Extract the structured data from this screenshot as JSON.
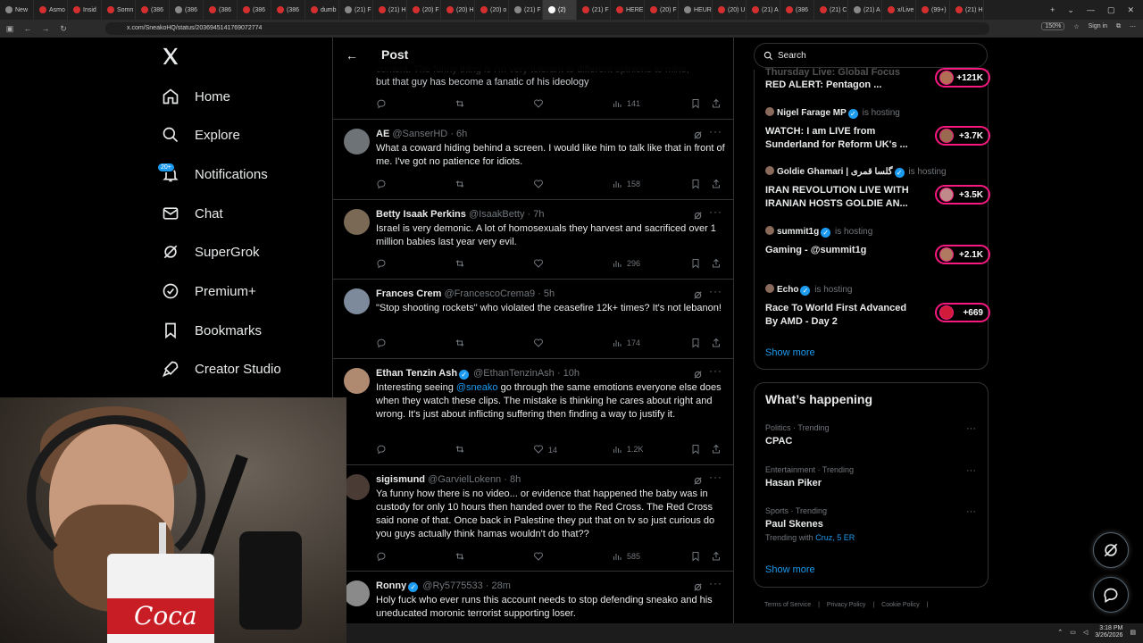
{
  "browser": {
    "tabs": [
      {
        "label": "New"
      },
      {
        "label": "Asmo"
      },
      {
        "label": "Insid"
      },
      {
        "label": "Somn"
      },
      {
        "label": "(386"
      },
      {
        "label": "(386"
      },
      {
        "label": "(386"
      },
      {
        "label": "(386"
      },
      {
        "label": "(386"
      },
      {
        "label": "dumb"
      },
      {
        "label": "(21) F"
      },
      {
        "label": "(21) H"
      },
      {
        "label": "(20) F"
      },
      {
        "label": "(20) H"
      },
      {
        "label": "(20) o"
      },
      {
        "label": "(21) F"
      },
      {
        "label": "(2)"
      },
      {
        "label": "(21) F"
      },
      {
        "label": "HERE"
      },
      {
        "label": "(20) F"
      },
      {
        "label": "HEUR"
      },
      {
        "label": "(20) U"
      },
      {
        "label": "(21) A"
      },
      {
        "label": "(386"
      },
      {
        "label": "(21) C"
      },
      {
        "label": "(21) A"
      },
      {
        "label": "x/Live"
      },
      {
        "label": "(99+)"
      },
      {
        "label": "(21) H"
      }
    ],
    "active_tab_index": 16,
    "url": "x.com/SneakoHQ/status/2036945141769072774",
    "zoom": "150%",
    "sign_in": "Sign in",
    "new_tab": "+"
  },
  "nav": {
    "items": [
      {
        "label": "Home",
        "icon": "home-icon"
      },
      {
        "label": "Explore",
        "icon": "search-icon"
      },
      {
        "label": "Notifications",
        "icon": "bell-icon"
      },
      {
        "label": "Chat",
        "icon": "mail-icon"
      },
      {
        "label": "SuperGrok",
        "icon": "grok-icon"
      },
      {
        "label": "Premium+",
        "icon": "verified-badge-icon"
      },
      {
        "label": "Bookmarks",
        "icon": "bookmark-icon"
      },
      {
        "label": "Creator Studio",
        "icon": "rocket-icon"
      }
    ],
    "notifications_badge": "20+"
  },
  "post": {
    "header_title": "Post",
    "partial_top": {
      "line1": "content. The funny thing is I'm very tolerant to different opinions to mine,",
      "line2": "but that guy has become a fanatic of his ideology",
      "views": "141"
    },
    "replies": [
      {
        "name": "AE",
        "handle": "@SanserHD",
        "time": "6h",
        "verified": false,
        "text": "What a coward hiding behind a screen. I would like him to talk like that in front of me. I've got no patience for idiots.",
        "likes": "",
        "views": "158"
      },
      {
        "name": "Betty Isaak Perkins",
        "handle": "@IsaakBetty",
        "time": "7h",
        "verified": false,
        "text": "Israel is very demonic. A lot of homosexuals they harvest and sacrificed over 1 million babies last year very evil.",
        "likes": "",
        "views": "296"
      },
      {
        "name": "Frances Crem",
        "handle": "@FrancescoCrema9",
        "time": "5h",
        "verified": false,
        "text": "\"Stop shooting rockets\" who violated the ceasefire 12k+ times? It's not lebanon!",
        "likes": "",
        "views": "174"
      },
      {
        "name": "Ethan Tenzin Ash",
        "handle": "@EthanTenzinAsh",
        "time": "10h",
        "verified": true,
        "text_before": "Interesting seeing ",
        "mention": "@sneako",
        "text": " go through the same emotions everyone else does when they watch these clips. The mistake is thinking he cares about right and wrong. It's just about inflicting suffering then finding a way to justify it.",
        "likes": "14",
        "views": "1.2K"
      },
      {
        "name": "sigismund",
        "handle": "@GarvielLokenn",
        "time": "8h",
        "verified": false,
        "text": "Ya funny how there is no video... or evidence that happened the baby was in custody for only 10 hours then handed over to the Red Cross. The Red Cross said none of that. Once back in Palestine they put that on tv so just curious do you guys actually think hamas wouldn't do that??",
        "likes": "",
        "views": "585"
      },
      {
        "name": "Ronny",
        "handle": "@Ry5775533",
        "time": "28m",
        "verified": true,
        "text": "Holy fuck who ever runs this account needs to stop defending sneako and his uneducated moronic terrorist supporting loser.",
        "likes": "",
        "views": ""
      }
    ]
  },
  "search": {
    "placeholder": "Search"
  },
  "live": {
    "partial_top": {
      "line1": "Thursday Live: Global Focus",
      "line2": "RED ALERT: Pentagon ...",
      "count": "+121K"
    },
    "hosting_label": "is hosting",
    "items": [
      {
        "host": "Nigel Farage MP",
        "title": "WATCH: I am LIVE from Sunderland for Reform UK's ...",
        "count": "+3.7K",
        "verified": true
      },
      {
        "host": "Goldie Ghamari | گلسا قمری",
        "title": "IRAN REVOLUTION LIVE WITH IRANIAN HOSTS GOLDIE AN...",
        "count": "+3.5K",
        "verified": true
      },
      {
        "host": "summit1g",
        "title": "Gaming - @summit1g",
        "count": "+2.1K",
        "verified": true
      },
      {
        "host": "Echo",
        "title": "Race To World First Advanced By AMD - Day 2",
        "count": "+669",
        "verified": true
      }
    ],
    "show_more": "Show more"
  },
  "happening": {
    "title": "What’s happening",
    "trends": [
      {
        "meta": "Politics · Trending",
        "name": "CPAC",
        "extra_prefix": "",
        "extra_link": ""
      },
      {
        "meta": "Entertainment · Trending",
        "name": "Hasan Piker",
        "extra_prefix": "",
        "extra_link": ""
      },
      {
        "meta": "Sports · Trending",
        "name": "Paul Skenes",
        "extra_prefix": "Trending with ",
        "extra_link": "Cruz, 5 ER"
      }
    ],
    "show_more": "Show more"
  },
  "footer": {
    "links": [
      "Terms of Service",
      "Privacy Policy",
      "Cookie Policy"
    ]
  },
  "webcam": {
    "cup_text": "Coca"
  },
  "taskbar": {
    "time": "3:18 PM",
    "date": "3/26/2026"
  },
  "colors": {
    "accent": "#1d9bf0",
    "live": "#f91880",
    "bg": "#000000",
    "muted": "#71767b"
  }
}
